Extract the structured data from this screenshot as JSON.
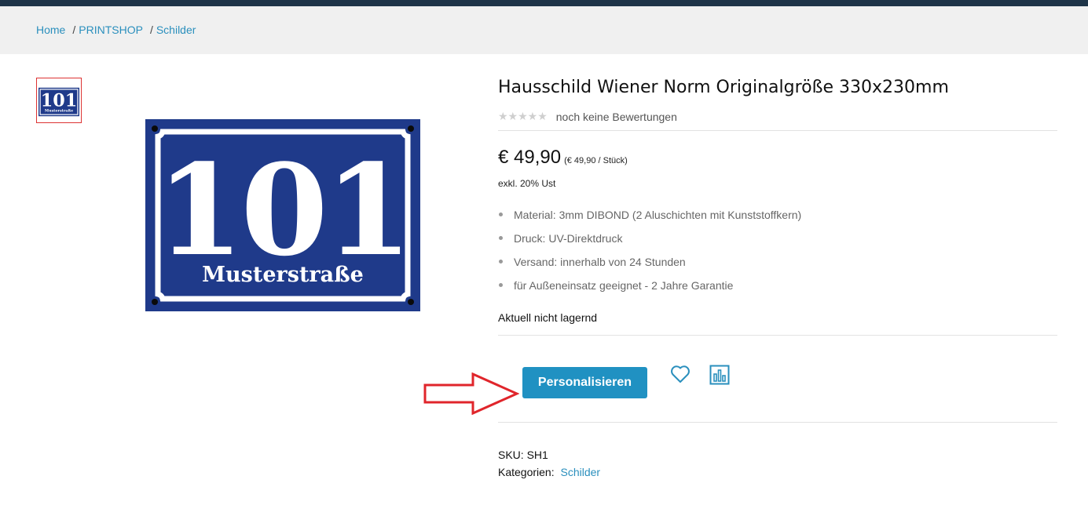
{
  "breadcrumb": {
    "items": [
      "Home",
      "PRINTSHOP",
      "Schilder"
    ],
    "separator": "/"
  },
  "product": {
    "title": "Hausschild Wiener Norm Originalgröße 330x230mm",
    "rating_text": "noch keine Bewertungen",
    "rating_stars": 0,
    "price": "€ 49,90",
    "unit_price": "(€ 49,90 / Stück)",
    "tax_note": "exkl. 20% Ust",
    "features": [
      "Material: 3mm DIBOND (2 Aluschichten mit Kunststoffkern)",
      "Druck: UV-Direktdruck",
      "Versand: innerhalb von 24 Stunden",
      "für Außeneinsatz geeignet - 2 Jahre Garantie"
    ],
    "stock_status": "Aktuell nicht lagernd",
    "personalize_label": "Personalisieren",
    "sku_label": "SKU:",
    "sku_value": "SH1",
    "categories_label": "Kategorien:",
    "category": "Schilder"
  },
  "sign": {
    "number": "101",
    "street": "Musterstraße"
  },
  "icons": {
    "wishlist": "heart-icon",
    "compare": "bar-chart-icon",
    "annotation": "red-arrow-icon"
  },
  "colors": {
    "accent": "#2091c2",
    "link": "#2a8fbd",
    "topbar": "#1e3448",
    "sign_blue": "#1f3a8a",
    "annotation_red": "#e0252b"
  }
}
